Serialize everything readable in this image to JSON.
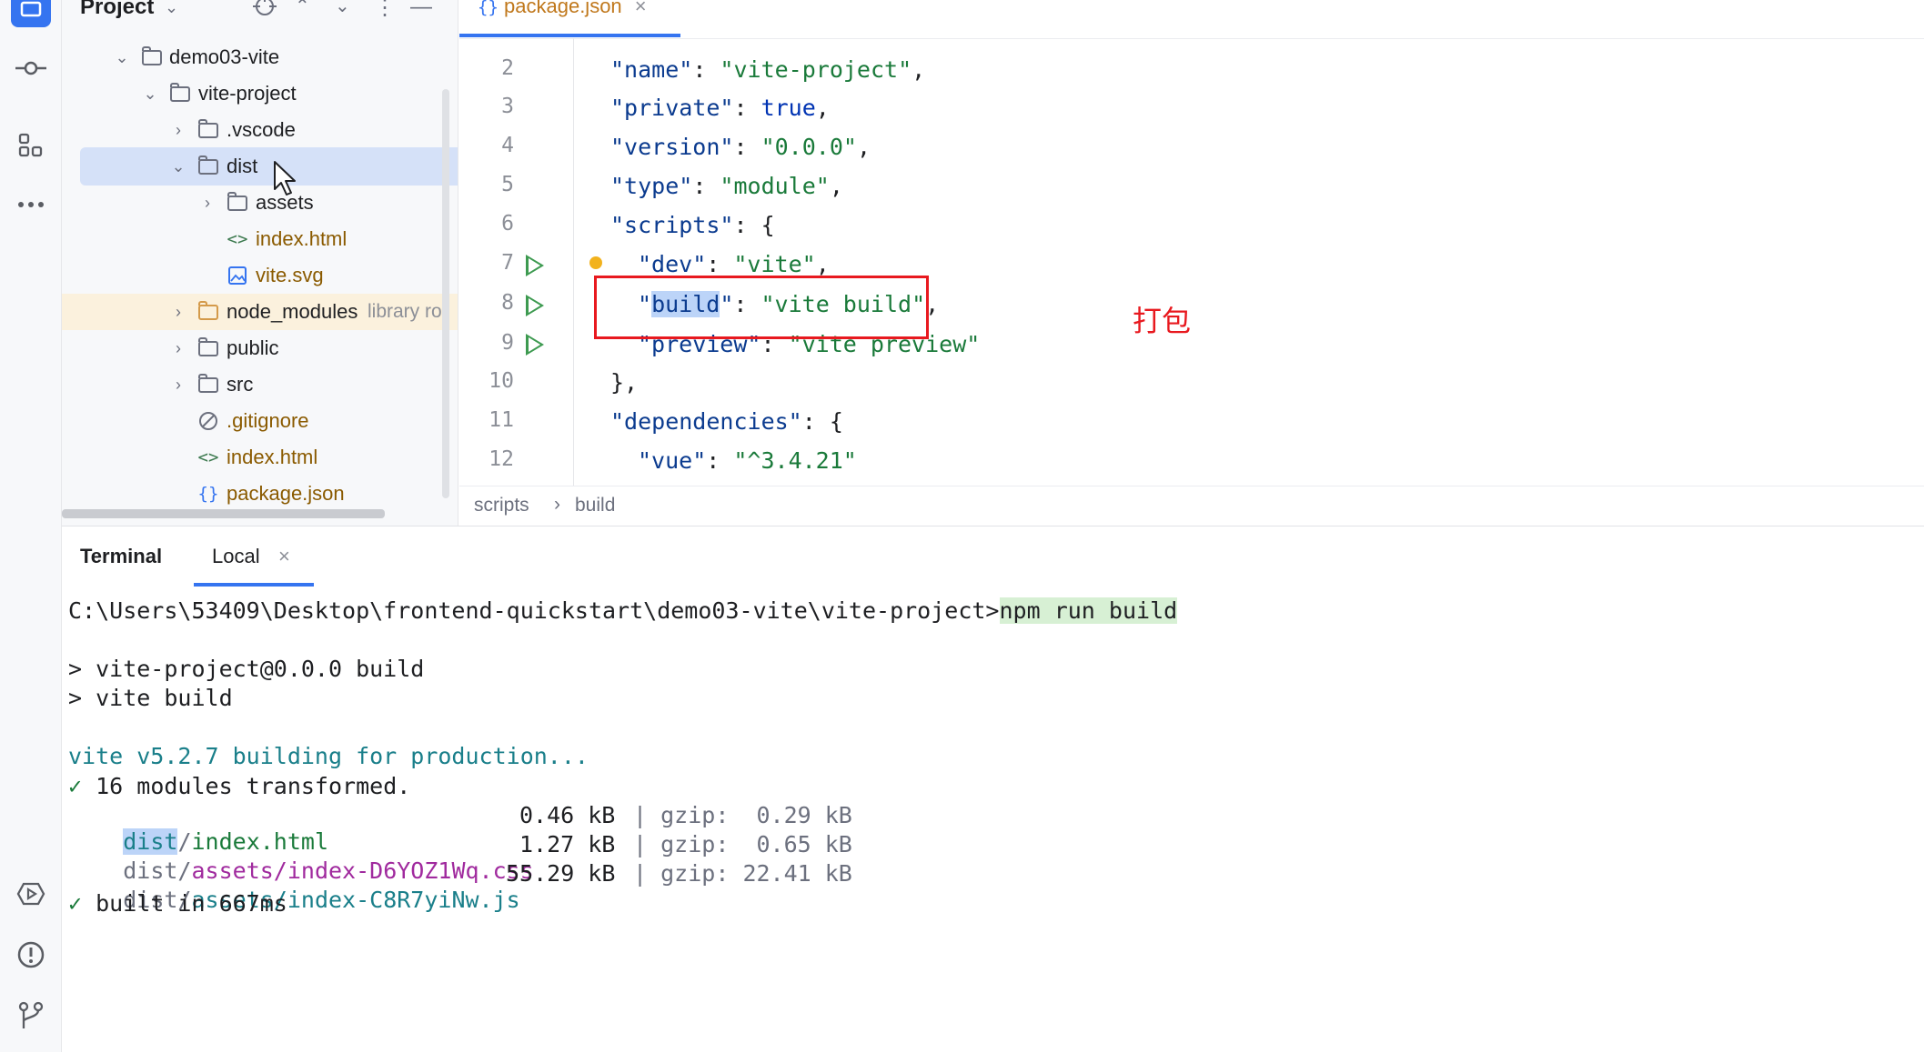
{
  "toolstrip": {
    "items": [
      {
        "name": "project-tool",
        "icon": "folder-icon"
      },
      {
        "name": "commit-tool",
        "icon": "commit-icon"
      },
      {
        "name": "structure-tool",
        "icon": "structure-icon"
      },
      {
        "name": "more-tool",
        "icon": "more-icon"
      },
      {
        "name": "services-tool",
        "icon": "services-icon"
      },
      {
        "name": "problems-tool",
        "icon": "problems-icon"
      },
      {
        "name": "git-tool",
        "icon": "git-icon"
      }
    ]
  },
  "project_panel": {
    "title": "Project",
    "tree": {
      "root": "demo03-vite",
      "project": "vite-project",
      "vscode": ".vscode",
      "dist": "dist",
      "assets": "assets",
      "dist_index": "index.html",
      "dist_svg": "vite.svg",
      "node_modules": "node_modules",
      "node_modules_hint": "library ro",
      "public": "public",
      "src": "src",
      "gitignore": ".gitignore",
      "index": "index.html",
      "package": "package.json"
    }
  },
  "editor": {
    "tab_label": "package.json",
    "tab_close": "×",
    "line_numbers": [
      "2",
      "3",
      "4",
      "5",
      "6",
      "7",
      "8",
      "9",
      "10",
      "11",
      "12"
    ],
    "lines": {
      "l2": {
        "key": "\"name\"",
        "sep": ": ",
        "val": "\"vite-project\"",
        "end": ","
      },
      "l3": {
        "key": "\"private\"",
        "sep": ": ",
        "val": "true",
        "end": ","
      },
      "l4": {
        "key": "\"version\"",
        "sep": ": ",
        "val": "\"0.0.0\"",
        "end": ","
      },
      "l5": {
        "key": "\"type\"",
        "sep": ": ",
        "val": "\"module\"",
        "end": ","
      },
      "l6": {
        "key": "\"scripts\"",
        "sep": ": ",
        "val": "{",
        "end": ""
      },
      "l7": {
        "key": "\"dev\"",
        "sep": ": ",
        "val": "\"vite\"",
        "end": ","
      },
      "l8": {
        "q1": "\"",
        "word": "build",
        "q2": "\"",
        "sep": ": ",
        "val": "\"vite build\"",
        "end": ","
      },
      "l9": {
        "key": "\"preview\"",
        "sep": ": ",
        "val": "\"vite preview\"",
        "end": ""
      },
      "l10": {
        "text": "},"
      },
      "l11": {
        "key": "\"dependencies\"",
        "sep": ": ",
        "val": "{",
        "end": ""
      },
      "l12": {
        "key": "\"vue\"",
        "sep": ": ",
        "val": "\"^3.4.21\"",
        "end": ""
      }
    },
    "annotation": "打包",
    "annotation_color": "#e8191f",
    "breadcrumb": [
      "scripts",
      "build"
    ],
    "breadcrumb_sep": "›"
  },
  "terminal": {
    "tab_terminal": "Terminal",
    "tab_local": "Local",
    "tab_close": "×",
    "prompt_path": "C:\\Users\\53409\\Desktop\\frontend-quickstart\\demo03-vite\\vite-project>",
    "command": "npm run build",
    "out1": "> vite-project@0.0.0 build",
    "out2": "> vite build",
    "vite_line": "vite v5.2.7 building for production...",
    "check": "✓",
    "transformed": " 16 modules transformed.",
    "files": [
      {
        "dir": "dist",
        "sub": "/",
        "name": "index.html",
        "size": "0.46 kB",
        "gzip_label": "gzip:",
        "gzip": " 0.29 kB"
      },
      {
        "dir": "dist/",
        "sub": "assets/",
        "name": "index-D6YOZ1Wq.css",
        "size": "1.27 kB",
        "gzip_label": "gzip:",
        "gzip": " 0.65 kB"
      },
      {
        "dir": "dist/",
        "sub": "assets/",
        "name": "index-C8R7yiNw.js",
        "size": "55.29 kB",
        "gzip_label": "gzip:",
        "gzip": "22.41 kB"
      }
    ],
    "built": " built in 667ms"
  }
}
